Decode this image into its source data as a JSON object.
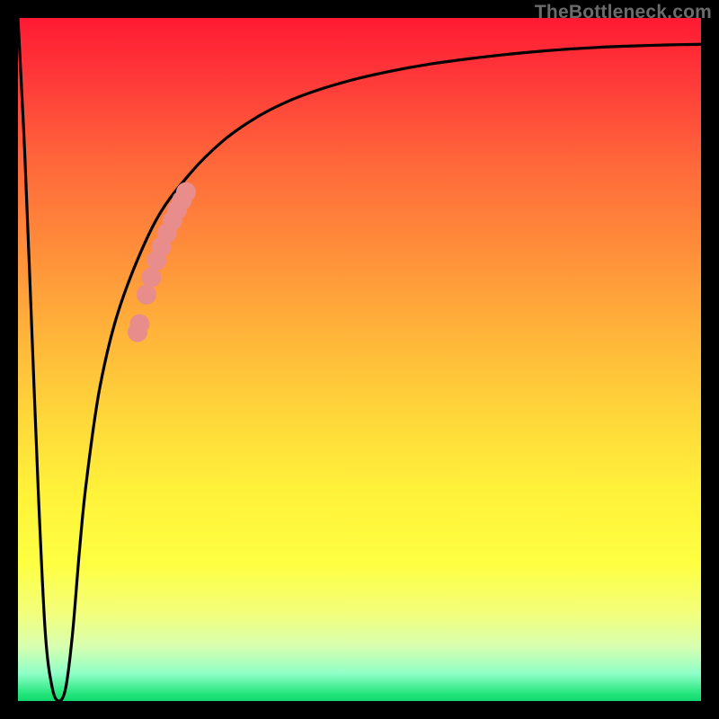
{
  "watermark": "TheBottleneck.com",
  "chart_data": {
    "type": "line",
    "title": "",
    "xlabel": "",
    "ylabel": "",
    "xlim": [
      0,
      100
    ],
    "ylim": [
      0,
      100
    ],
    "grid": false,
    "series": [
      {
        "name": "bottleneck-curve",
        "color": "#000000",
        "x": [
          0,
          1,
          2,
          3,
          4,
          5,
          6,
          7,
          8,
          9,
          10,
          12,
          15,
          20,
          25,
          30,
          35,
          40,
          45,
          50,
          55,
          60,
          65,
          70,
          75,
          80,
          85,
          90,
          95,
          100
        ],
        "y": [
          100,
          80,
          55,
          30,
          10,
          2,
          0,
          2,
          10,
          22,
          32,
          46,
          58,
          70,
          77,
          82,
          85.5,
          88,
          89.8,
          91.2,
          92.3,
          93.2,
          93.9,
          94.5,
          95,
          95.4,
          95.7,
          95.9,
          96.05,
          96.15
        ]
      },
      {
        "name": "highlight-cluster",
        "type": "scatter",
        "color": "#e98c8c",
        "x": [
          17.5,
          17.8,
          18.8,
          19.5,
          20.3,
          21.0,
          21.8,
          22.6,
          23.3,
          24.0,
          24.6
        ],
        "y": [
          54.0,
          55.2,
          59.5,
          62.0,
          64.5,
          66.5,
          68.5,
          70.3,
          71.9,
          73.3,
          74.5
        ]
      }
    ],
    "colors": {
      "gradient_top": "#ff1a33",
      "gradient_mid": "#fff33a",
      "gradient_bottom": "#10d86d",
      "curve": "#000000",
      "highlight": "#e98c8c",
      "frame": "#000000"
    }
  }
}
